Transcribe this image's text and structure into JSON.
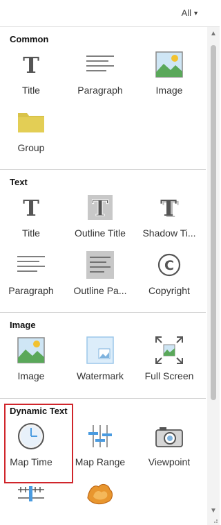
{
  "filter": {
    "label": "All"
  },
  "sections": [
    {
      "title": "Common",
      "items": [
        {
          "label": "Title",
          "icon": "title-t-icon"
        },
        {
          "label": "Paragraph",
          "icon": "paragraph-lines-icon"
        },
        {
          "label": "Image",
          "icon": "image-landscape-icon"
        },
        {
          "label": "Group",
          "icon": "folder-icon"
        }
      ]
    },
    {
      "title": "Text",
      "items": [
        {
          "label": "Title",
          "icon": "title-t-icon"
        },
        {
          "label": "Outline Title",
          "icon": "outline-title-icon"
        },
        {
          "label": "Shadow Ti...",
          "icon": "shadow-title-icon"
        },
        {
          "label": "Paragraph",
          "icon": "paragraph-lines-icon"
        },
        {
          "label": "Outline Pa...",
          "icon": "outline-paragraph-icon"
        },
        {
          "label": "Copyright",
          "icon": "copyright-icon"
        }
      ]
    },
    {
      "title": "Image",
      "items": [
        {
          "label": "Image",
          "icon": "image-landscape-icon"
        },
        {
          "label": "Watermark",
          "icon": "watermark-icon"
        },
        {
          "label": "Full Screen",
          "icon": "fullscreen-image-icon"
        }
      ]
    },
    {
      "title": "Dynamic Text",
      "items": [
        {
          "label": "Map Time",
          "icon": "clock-icon"
        },
        {
          "label": "Map Range",
          "icon": "range-slider-icon"
        },
        {
          "label": "Viewpoint",
          "icon": "camera-icon"
        },
        {
          "label": "",
          "icon": "scale-bar-icon"
        },
        {
          "label": "",
          "icon": "contour-shape-icon"
        }
      ]
    }
  ],
  "colors": {
    "highlight": "#d0252b",
    "accent_blue": "#4a9be0",
    "folder": "#d9c34a"
  }
}
